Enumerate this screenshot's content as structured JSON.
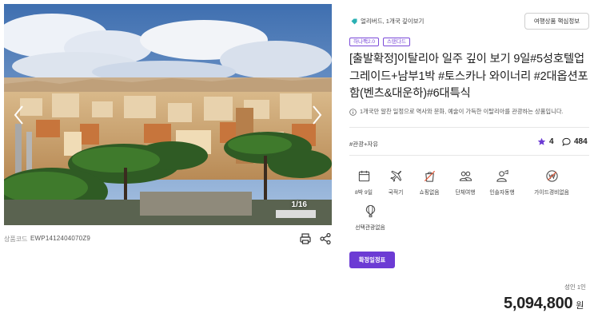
{
  "gallery": {
    "counter": "1/16"
  },
  "product": {
    "code_label": "상품코드",
    "code_value": "EWP1412404070Z9",
    "category": "얼리버드, 1개국 깊이보기",
    "info_button": "여행상품 핵심정보",
    "badges": [
      "하나팩2.0",
      "스탠다드"
    ],
    "title": "[출발확정]이탈리아 일주 깊이 보기 9일#5성호텔업그레이드+남부1박 #토스카나 와이너리 #2대옵션포함(벤츠&대운하)#6대특식",
    "description": "1개국만 알찬 일정으로 역사와 문화, 예술이 가득한 이탈리아를 관광하는 상품입니다.",
    "hashtag": "#관광+자유",
    "rating": "4",
    "comments": "484"
  },
  "features": [
    {
      "label": "8박 9일",
      "icon": "calendar-icon"
    },
    {
      "label": "국적기",
      "icon": "airplane-icon"
    },
    {
      "label": "쇼핑없음",
      "icon": "no-shopping-icon"
    },
    {
      "label": "단체여행",
      "icon": "group-icon"
    },
    {
      "label": "인솔자동행",
      "icon": "guide-icon"
    },
    {
      "label": "가이드경비없음",
      "icon": "no-guide-fee-icon"
    },
    {
      "label": "선택관광없음",
      "icon": "balloon-icon"
    }
  ],
  "schedule_button": "확정일정표",
  "price": {
    "label": "성인 1인",
    "amount": "5,094,800",
    "unit": "원"
  },
  "colors": {
    "accent": "#6c3bd4",
    "badge": "#7b4ad8",
    "category_icon": "#2ab0b3"
  }
}
